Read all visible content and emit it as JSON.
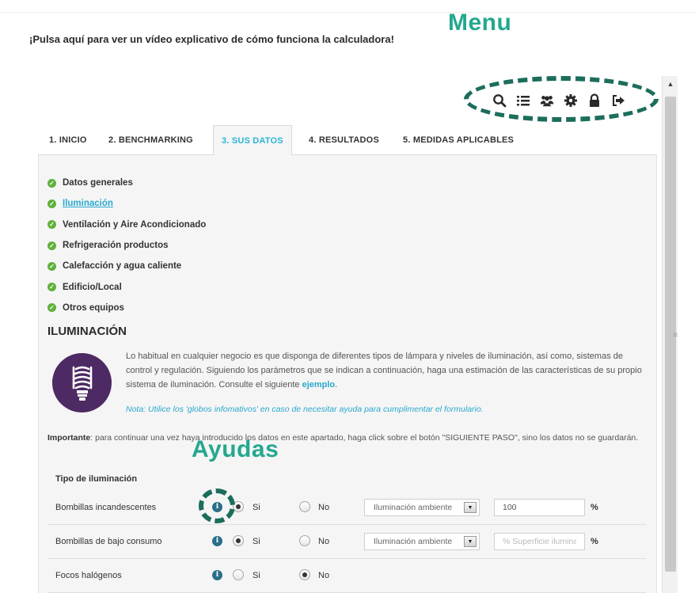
{
  "header": {
    "video_link": "¡Pulsa aquí para ver un vídeo explicativo de cómo funciona la calculadora!",
    "menu_annotation": "Menu"
  },
  "toolbar": {
    "icons": [
      "search-icon",
      "list-icon",
      "users-icon",
      "gear-icon",
      "lock-icon",
      "logout-icon"
    ]
  },
  "tabs": [
    {
      "label": "1. INICIO",
      "active": false
    },
    {
      "label": "2. BENCHMARKING",
      "active": false
    },
    {
      "label": "3. SUS DATOS",
      "active": true
    },
    {
      "label": "4. RESULTADOS",
      "active": false
    },
    {
      "label": "5. MEDIDAS APLICABLES",
      "active": false
    }
  ],
  "sections": [
    {
      "label": "Datos generales",
      "active": false
    },
    {
      "label": "Iluminación",
      "active": true
    },
    {
      "label": "Ventilación y Aire Acondicionado",
      "active": false
    },
    {
      "label": "Refrigeración productos",
      "active": false
    },
    {
      "label": "Calefacción y agua caliente",
      "active": false
    },
    {
      "label": "Edificio/Local",
      "active": false
    },
    {
      "label": "Otros equipos",
      "active": false
    }
  ],
  "main": {
    "heading": "ILUMINACIÓN",
    "intro_text": "Lo habitual en cualquier negocio es que disponga de diferentes tipos de lámpara y niveles de iluminación,  así como, sistemas de control y regulación. Siguiendo los parámetros que se indican a continuación, haga una estimación de las características de su propio sistema de iluminación. Consulte el siguiente",
    "intro_link": "ejemplo",
    "intro_end": ".",
    "note": "Nota: Utilice los 'globos infomativos' en caso de necesitar ayuda para cumplimentar el formulario.",
    "important_label": "Importante",
    "important_text": ": para continuar una vez haya introducido los datos en este apartado, haga click sobre el botón \"SIGUIENTE PASO\", sino los datos no se guardarán.",
    "ayudas_annotation": "Ayudas",
    "subhead": "Tipo de iluminación"
  },
  "options": {
    "yes": "Si",
    "no": "No",
    "pct": "%"
  },
  "rows": [
    {
      "label": "Bombillas incandescentes",
      "selected": "si",
      "select_value": "Iluminación ambiente",
      "input_value": "100",
      "input_placeholder": ""
    },
    {
      "label": "Bombillas de bajo consumo",
      "selected": "si",
      "select_value": "Iluminación ambiente",
      "input_value": "",
      "input_placeholder": "% Superficie iluminada"
    },
    {
      "label": "Focos halógenos",
      "selected": "no"
    }
  ],
  "colors": {
    "accent": "#2aa9cf",
    "annotation": "#24a88f",
    "annotation_dash": "#1c6d5c",
    "check": "#5fb13a",
    "bulb_bg": "#4d2a63",
    "info": "#2b6f8a"
  }
}
